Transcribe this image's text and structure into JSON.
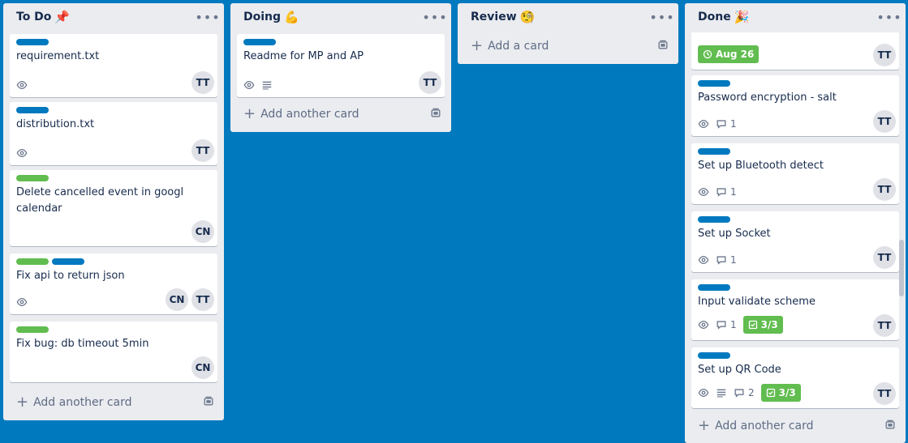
{
  "colors": {
    "board_bg": "#0079bf",
    "label_blue": "#0079bf",
    "label_green": "#61bd4f"
  },
  "lists": [
    {
      "title": "To Do",
      "emoji": "📌",
      "cards": [
        {
          "title": "requirement.txt",
          "labels": [
            "blue"
          ],
          "badges": [
            "eye"
          ],
          "members": [
            "TT"
          ]
        },
        {
          "title": "distribution.txt",
          "labels": [
            "blue"
          ],
          "badges": [
            "eye"
          ],
          "members": [
            "TT"
          ]
        },
        {
          "title": "Delete cancelled event in googl calendar",
          "labels": [
            "green"
          ],
          "badges": [],
          "members": [
            "CN"
          ]
        },
        {
          "title": "Fix api to return json",
          "labels": [
            "green",
            "blue"
          ],
          "badges": [
            "eye"
          ],
          "members": [
            "CN",
            "TT"
          ]
        },
        {
          "title": "Fix bug: db timeout 5min",
          "labels": [
            "green"
          ],
          "badges": [],
          "members": [
            "CN"
          ]
        }
      ],
      "add_label": "Add another card"
    },
    {
      "title": "Doing",
      "emoji": "💪",
      "cards": [
        {
          "title": "Readme for MP and AP",
          "labels": [
            "blue"
          ],
          "badges": [
            "eye",
            "description"
          ],
          "members": [
            "TT"
          ]
        }
      ],
      "add_label": "Add another card"
    },
    {
      "title": "Review",
      "emoji": "🧐",
      "cards": [],
      "add_label": "Add a card"
    },
    {
      "title": "Done",
      "emoji": "🎉",
      "cards": [
        {
          "title": "",
          "due": "Aug 26",
          "members": [
            "TT"
          ]
        },
        {
          "title": "Password encryption - salt",
          "labels": [
            "blue"
          ],
          "comments": "1",
          "members": [
            "TT"
          ]
        },
        {
          "title": "Set up Bluetooth detect",
          "labels": [
            "blue"
          ],
          "comments": "1",
          "members": [
            "TT"
          ]
        },
        {
          "title": "Set up Socket",
          "labels": [
            "blue"
          ],
          "comments": "1",
          "members": [
            "TT"
          ]
        },
        {
          "title": "Input validate scheme",
          "labels": [
            "blue"
          ],
          "comments": "1",
          "checklist": "3/3",
          "members": [
            "TT"
          ]
        },
        {
          "title": "Set up QR Code",
          "labels": [
            "blue"
          ],
          "comments": "2",
          "checklist": "3/3",
          "description": true,
          "members": [
            "TT"
          ]
        }
      ],
      "add_label": "Add another card"
    }
  ]
}
